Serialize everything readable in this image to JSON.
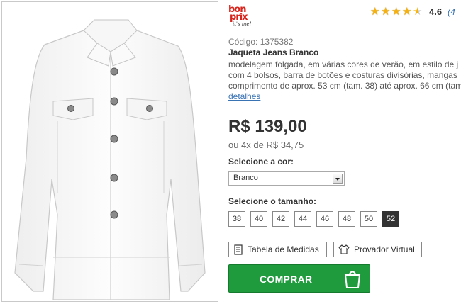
{
  "product_image": {
    "alt": "Jaqueta Jeans Branco"
  },
  "brand": {
    "line1": "bon",
    "line2": "prix",
    "tagline": "it's me!"
  },
  "rating": {
    "value": "4.6",
    "stars": 4.5,
    "review_count": "(4",
    "star_color": "#f6b10d"
  },
  "product": {
    "code": "Código: 1375382",
    "title": "Jaqueta Jeans Branco",
    "description_lines": [
      "modelagem folgada, em várias cores de verão, em estilo de j",
      "com 4 bolsos, barra de botões e costuras divisórias, mangas",
      "comprimento de aprox. 53 cm (tam. 38) até aprox. 66 cm (tam"
    ],
    "details_link": "detalhes"
  },
  "pricing": {
    "price": "R$ 139,00",
    "installments": "ou 4x de R$ 34,75"
  },
  "color": {
    "label": "Selecione a cor:",
    "selected": "Branco"
  },
  "size": {
    "label": "Selecione o tamanho:",
    "options": [
      "38",
      "40",
      "42",
      "44",
      "46",
      "48",
      "50",
      "52"
    ],
    "selected": "52"
  },
  "actions": {
    "measurements_label": "Tabela de Medidas",
    "fitting_label": "Provador Virtual",
    "buy_label": "COMPRAR",
    "buy_color": "#1f9a3d"
  }
}
